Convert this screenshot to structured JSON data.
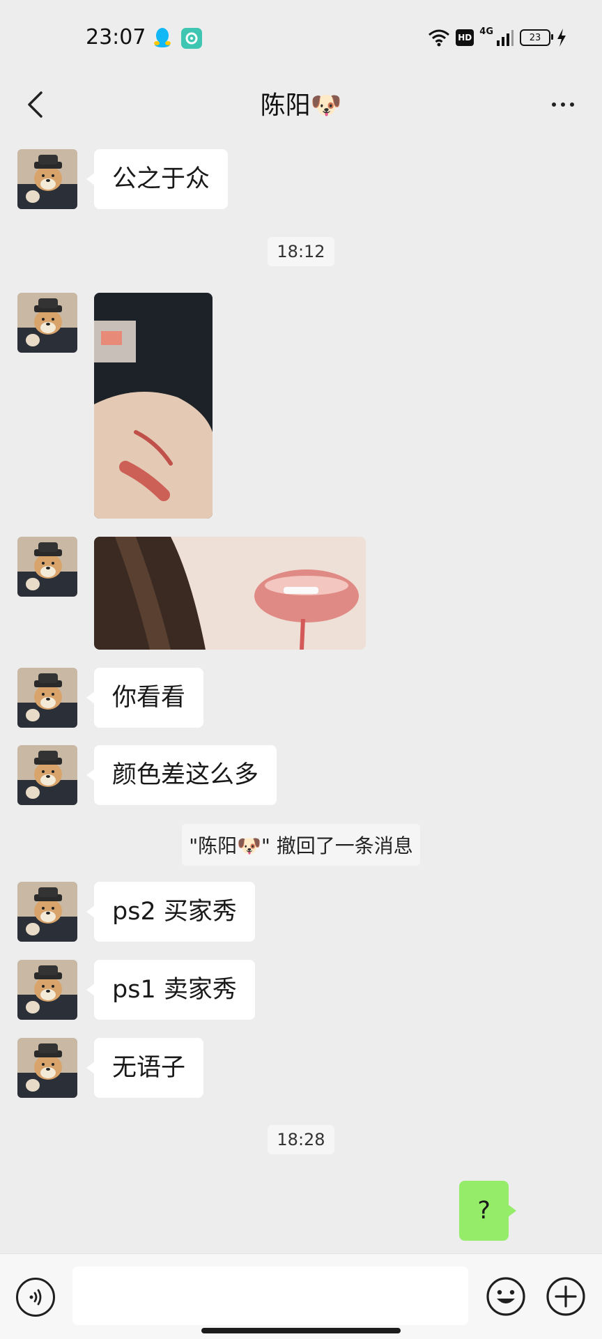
{
  "status_bar": {
    "time": "23:07",
    "network": "4G",
    "hd": "HD",
    "battery": "23"
  },
  "header": {
    "title": "陈阳🐶"
  },
  "messages": [
    {
      "type": "text",
      "side": "left",
      "text": "公之于众"
    },
    {
      "type": "time",
      "text": "18:12"
    },
    {
      "type": "image",
      "side": "left",
      "description": "hand-swatch-photo"
    },
    {
      "type": "image",
      "side": "left",
      "description": "lips-photo"
    },
    {
      "type": "text",
      "side": "left",
      "text": "你看看"
    },
    {
      "type": "text",
      "side": "left",
      "text": "颜色差这么多"
    },
    {
      "type": "recall",
      "text": "\"陈阳🐶\" 撤回了一条消息"
    },
    {
      "type": "text",
      "side": "left",
      "text": "ps2 买家秀"
    },
    {
      "type": "text",
      "side": "left",
      "text": "ps1 卖家秀"
    },
    {
      "type": "text",
      "side": "left",
      "text": "无语子"
    },
    {
      "type": "time",
      "text": "18:28"
    },
    {
      "type": "text",
      "side": "right",
      "text": "?"
    }
  ],
  "input": {
    "value": "",
    "placeholder": ""
  },
  "colors": {
    "background": "#ededed",
    "bubble_self": "#95ec69",
    "bubble_other": "#ffffff"
  }
}
